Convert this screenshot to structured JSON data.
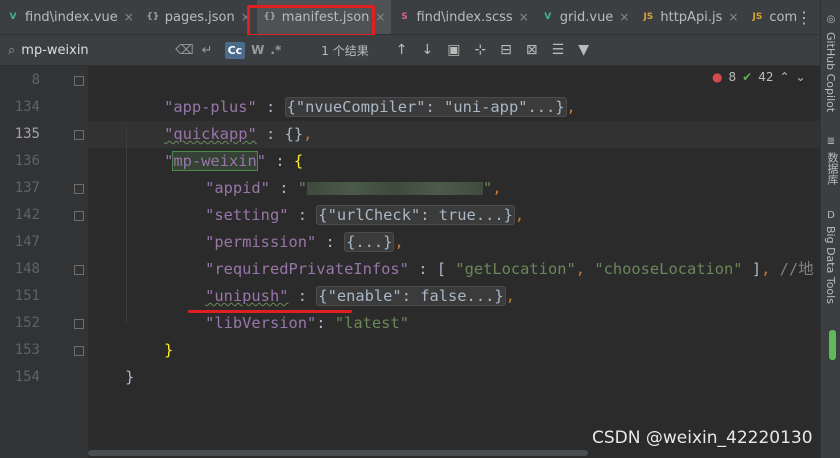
{
  "tabs": [
    {
      "label": "find\\index.vue",
      "icon": "vue-icon",
      "icon_glyph": "V",
      "icon_color": "#41b883"
    },
    {
      "label": "pages.json",
      "icon": "json-icon",
      "icon_glyph": "{}",
      "icon_color": "#a0a0a0"
    },
    {
      "label": "manifest.json",
      "icon": "json-icon",
      "icon_glyph": "{}",
      "icon_color": "#a0a0a0",
      "active": true
    },
    {
      "label": "find\\index.scss",
      "icon": "scss-icon",
      "icon_glyph": "S",
      "icon_color": "#cf649a"
    },
    {
      "label": "grid.vue",
      "icon": "vue-icon",
      "icon_glyph": "V",
      "icon_color": "#41b883"
    },
    {
      "label": "httpApi.js",
      "icon": "js-icon",
      "icon_glyph": "JS",
      "icon_color": "#d6a23a"
    },
    {
      "label": "com",
      "icon": "js-icon",
      "icon_glyph": "JS",
      "icon_color": "#d6a23a"
    }
  ],
  "tab_close_glyph": "×",
  "search": {
    "query": "mp-weixin",
    "match_case_label": "Cc",
    "words_label": "W",
    "regex_label": ".*",
    "results": "1 个结果"
  },
  "inspections": {
    "errors": "8",
    "warnings": "42"
  },
  "lines": {
    "n8": "8",
    "n134": "134",
    "n135": "135",
    "n136": "136",
    "n137": "137",
    "n142": "142",
    "n147": "147",
    "n148": "148",
    "n151": "151",
    "n152": "152",
    "n153": "153",
    "n154": "154"
  },
  "code": {
    "l8_key": "\"app-plus\"",
    "l8_fold": "{\"nvueCompiler\": \"uni-app\"...}",
    "l134_key": "\"quickapp\"",
    "l134_val": "{}",
    "l135_key_q1": "\"",
    "l135_key": "mp-weixin",
    "l135_key_q2": "\"",
    "l136_key": "\"appid\"",
    "l136_q1": "\"",
    "l136_q2": "\"",
    "l137_key": "\"setting\"",
    "l137_fold": "{\"urlCheck\": true...}",
    "l142_key": "\"permission\"",
    "l142_fold": "{...}",
    "l147_key": "\"requiredPrivateInfos\"",
    "l147_v1": "\"getLocation\"",
    "l147_v2": "\"chooseLocation\"",
    "l147_comment": "//地",
    "l148_key": "\"unipush\"",
    "l148_fold": "{\"enable\": false...}",
    "l151_key": "\"libVersion\"",
    "l151_val": "\"latest\"",
    "colon": " : ",
    "colon_tight": ": ",
    "comma": ",",
    "open_brace": "{",
    "close_brace": "}",
    "open_bracket": "[ ",
    "close_bracket": " ]",
    "sep": ", "
  },
  "sidebar": {
    "copilot": "GitHub Copilot",
    "database": "数据库",
    "bigdata": "Big Data Tools"
  },
  "watermark": "CSDN @weixin_42220130",
  "colors": {
    "highlight_red": "#e02020",
    "key_purple": "#9876aa",
    "string_green": "#6a8759"
  }
}
